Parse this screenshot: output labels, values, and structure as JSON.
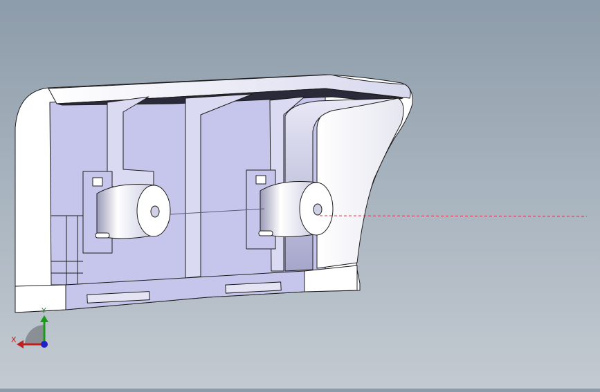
{
  "window": {
    "background_top": "#8d9caa",
    "background_bottom": "#c3cad1"
  },
  "model": {
    "name": "",
    "face_color": "#c6c6ec",
    "edge_color": "#1c1c1c",
    "highlight_color": "#ffffff",
    "section_line_color": "#d0304a"
  },
  "triad": {
    "x_label": "X",
    "y_label": "Y",
    "x_color": "#c02020",
    "y_color": "#1a9a1a",
    "z_color": "#2020c8"
  }
}
